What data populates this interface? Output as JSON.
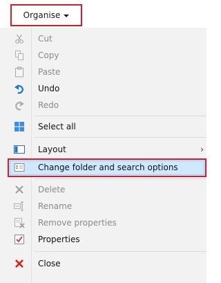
{
  "toolbar": {
    "organise_label": "Organise"
  },
  "menu": {
    "items": [
      {
        "label": "Cut",
        "icon": "scissors-icon",
        "enabled": false
      },
      {
        "label": "Copy",
        "icon": "copy-icon",
        "enabled": false
      },
      {
        "label": "Paste",
        "icon": "clipboard-icon",
        "enabled": false
      },
      {
        "label": "Undo",
        "icon": "undo-icon",
        "enabled": true
      },
      {
        "label": "Redo",
        "icon": "redo-icon",
        "enabled": false
      },
      {
        "label": "Select all",
        "icon": "select-all-icon",
        "enabled": true
      },
      {
        "label": "Layout",
        "icon": "layout-icon",
        "enabled": true,
        "submenu": "›"
      },
      {
        "label": "Change folder and search options",
        "icon": "folder-options-icon",
        "enabled": true,
        "highlighted": true
      },
      {
        "label": "Delete",
        "icon": "delete-icon",
        "enabled": false
      },
      {
        "label": "Rename",
        "icon": "rename-icon",
        "enabled": false
      },
      {
        "label": "Remove properties",
        "icon": "remove-properties-icon",
        "enabled": false
      },
      {
        "label": "Properties",
        "icon": "properties-icon",
        "enabled": true
      },
      {
        "label": "Close",
        "icon": "close-icon",
        "enabled": true
      }
    ]
  },
  "colors": {
    "highlight_border": "#d81b27",
    "hover_fill": "#cde8ff",
    "menu_background": "#f2f2f2"
  }
}
